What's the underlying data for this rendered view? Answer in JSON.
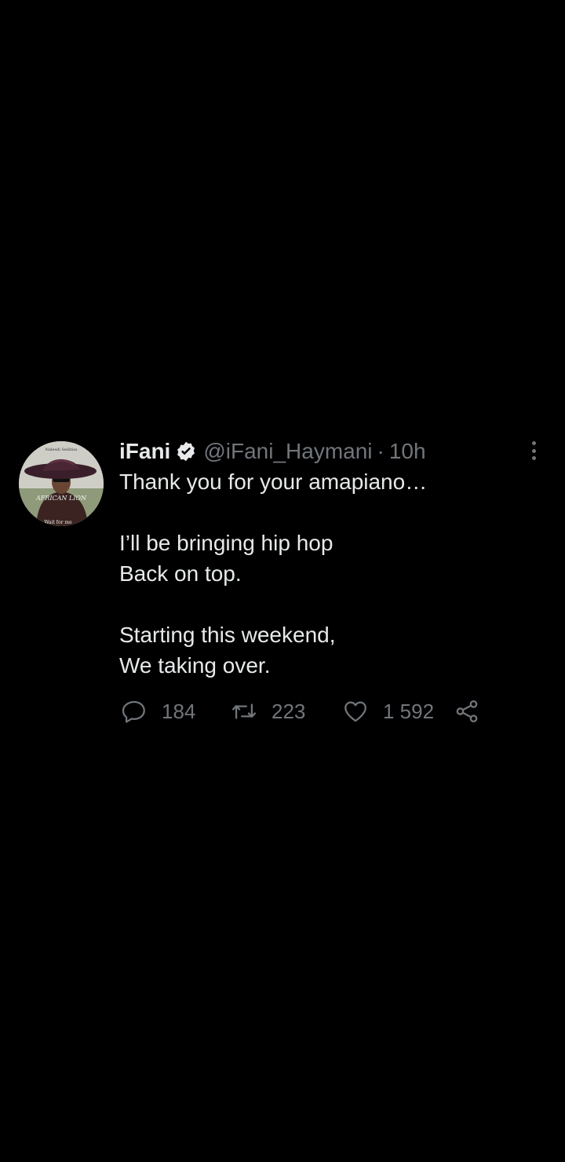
{
  "tweet": {
    "author_name": "iFani",
    "handle": "@iFani_Haymani",
    "separator": "·",
    "time": "10h",
    "avatar_texts": {
      "top": "Nalesdi Seilitiss",
      "middle": "AFRICAN LION",
      "bottom": "Wait for me"
    },
    "lines": [
      "Thank you for your amapiano…",
      "",
      "I’ll be bringing hip hop",
      "Back on top.",
      "",
      "Starting this weekend,",
      "We taking over."
    ],
    "reply_count": "184",
    "retweet_count": "223",
    "like_count": "1 592"
  },
  "colors": {
    "background": "#000000",
    "text": "#e7e9ea",
    "muted": "#71767b"
  },
  "icons": [
    "verified-badge-icon",
    "more-vertical-icon",
    "reply-icon",
    "retweet-icon",
    "like-icon",
    "share-icon"
  ]
}
